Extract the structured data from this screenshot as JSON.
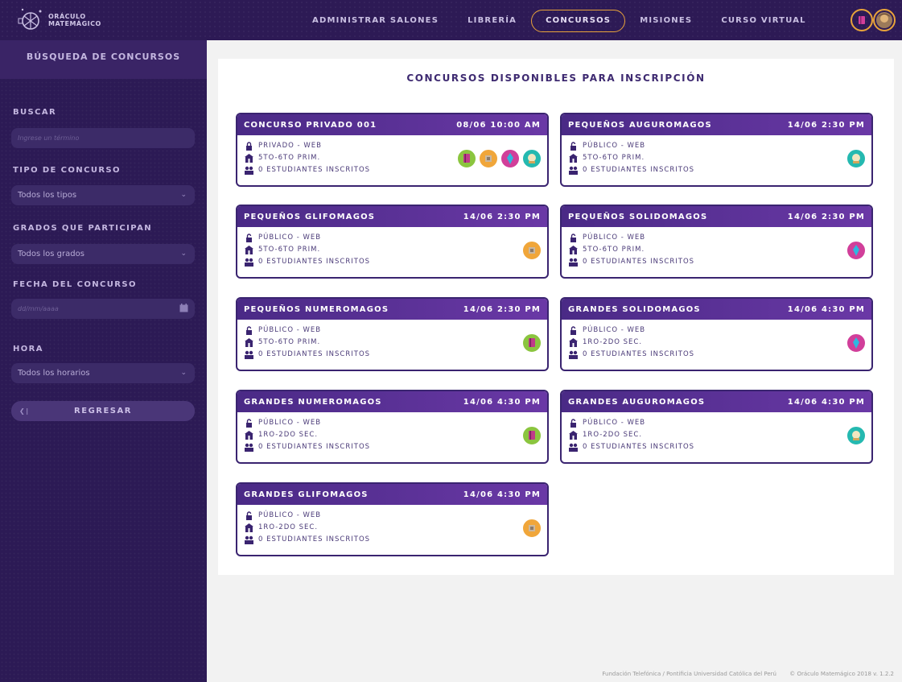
{
  "app": {
    "logo_line1": "ORÁCULO",
    "logo_line2": "MATEMÁGICO"
  },
  "nav": {
    "items": [
      {
        "label": "ADMINISTRAR SALONES"
      },
      {
        "label": "LIBRERÍA"
      },
      {
        "label": "CONCURSOS"
      },
      {
        "label": "MISIONES"
      },
      {
        "label": "CURSO VIRTUAL"
      }
    ],
    "active": "CONCURSOS"
  },
  "sidebar": {
    "title": "BÚSQUEDA DE CONCURSOS",
    "search_label": "BUSCAR",
    "search_placeholder": "Ingrese un término",
    "type_label": "TIPO DE CONCURSO",
    "type_value": "Todos los tipos",
    "grades_label": "GRADOS QUE PARTICIPAN",
    "grades_value": "Todos los grados",
    "date_label": "FECHA DEL CONCURSO",
    "date_placeholder": "dd/mm/aaaa",
    "time_label": "HORA",
    "time_value": "Todos los horarios",
    "back_label": "REGRESAR"
  },
  "main": {
    "title": "CONCURSOS DISPONIBLES PARA INSCRIPCIÓN",
    "contests": [
      {
        "name": "CONCURSO PRIVADO 001",
        "datetime": "08/06 10:00 AM",
        "access": "PRIVADO - WEB",
        "grades": "5TO-6TO PRIM.",
        "students": "0 ESTUDIANTES INSCRITOS",
        "locked": true,
        "badges": [
          "book",
          "cube",
          "crystal",
          "orb"
        ]
      },
      {
        "name": "PEQUEÑOS AUGUROMAGOS",
        "datetime": "14/06 2:30 PM",
        "access": "PÚBLICO - WEB",
        "grades": "5TO-6TO PRIM.",
        "students": "0 ESTUDIANTES INSCRITOS",
        "locked": false,
        "badges": [
          "orb"
        ]
      },
      {
        "name": "PEQUEÑOS GLIFOMAGOS",
        "datetime": "14/06 2:30 PM",
        "access": "PÚBLICO - WEB",
        "grades": "5TO-6TO PRIM.",
        "students": "0 ESTUDIANTES INSCRITOS",
        "locked": false,
        "badges": [
          "cube"
        ]
      },
      {
        "name": "PEQUEÑOS SOLIDOMAGOS",
        "datetime": "14/06 2:30 PM",
        "access": "PÚBLICO - WEB",
        "grades": "5TO-6TO PRIM.",
        "students": "0 ESTUDIANTES INSCRITOS",
        "locked": false,
        "badges": [
          "crystal"
        ]
      },
      {
        "name": "PEQUEÑOS NUMEROMAGOS",
        "datetime": "14/06 2:30 PM",
        "access": "PÚBLICO - WEB",
        "grades": "5TO-6TO PRIM.",
        "students": "0 ESTUDIANTES INSCRITOS",
        "locked": false,
        "badges": [
          "book"
        ]
      },
      {
        "name": "GRANDES SOLIDOMAGOS",
        "datetime": "14/06 4:30 PM",
        "access": "PÚBLICO - WEB",
        "grades": "1RO-2DO SEC.",
        "students": "0 ESTUDIANTES INSCRITOS",
        "locked": false,
        "badges": [
          "crystal"
        ]
      },
      {
        "name": "GRANDES NUMEROMAGOS",
        "datetime": "14/06 4:30 PM",
        "access": "PÚBLICO - WEB",
        "grades": "1RO-2DO SEC.",
        "students": "0 ESTUDIANTES INSCRITOS",
        "locked": false,
        "badges": [
          "book"
        ]
      },
      {
        "name": "GRANDES AUGUROMAGOS",
        "datetime": "14/06 4:30 PM",
        "access": "PÚBLICO - WEB",
        "grades": "1RO-2DO SEC.",
        "students": "0 ESTUDIANTES INSCRITOS",
        "locked": false,
        "badges": [
          "orb"
        ]
      },
      {
        "name": "GRANDES GLIFOMAGOS",
        "datetime": "14/06 4:30 PM",
        "access": "PÚBLICO - WEB",
        "grades": "1RO-2DO SEC.",
        "students": "0 ESTUDIANTES INSCRITOS",
        "locked": false,
        "badges": [
          "cube"
        ]
      }
    ]
  },
  "footer": {
    "org": "Fundación Telefónica / Pontificia Universidad Católica del Perú",
    "copyright": "© Oráculo Matemágico 2018 v. 1.2.2"
  },
  "colors": {
    "accent": "#e8a33a",
    "header_purple": "#4a2a86",
    "sidebar": "#2c1a55",
    "badge_book": "#8bc53f",
    "badge_cube": "#f0a63a",
    "badge_crystal": "#d13f9a",
    "badge_orb": "#25b9b0"
  }
}
